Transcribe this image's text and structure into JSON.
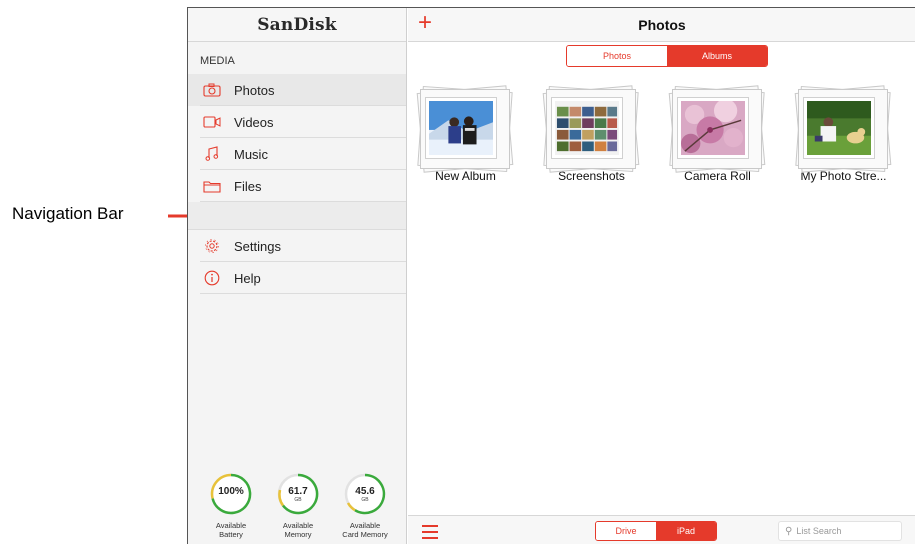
{
  "annotation": {
    "label": "Navigation Bar"
  },
  "sidebar": {
    "logo": "SanDisk",
    "section": "MEDIA",
    "media_items": [
      {
        "label": "Photos",
        "icon": "camera-icon",
        "active": true
      },
      {
        "label": "Videos",
        "icon": "video-icon"
      },
      {
        "label": "Music",
        "icon": "music-note-icon"
      },
      {
        "label": "Files",
        "icon": "folder-icon"
      }
    ],
    "other_items": [
      {
        "label": "Settings",
        "icon": "gear-icon"
      },
      {
        "label": "Help",
        "icon": "info-icon"
      }
    ],
    "gauges": [
      {
        "value": "100%",
        "unit": "",
        "label_line1": "Available",
        "label_line2": "Battery",
        "fraction": 1.0
      },
      {
        "value": "61.7",
        "unit": "GB",
        "label_line1": "Available",
        "label_line2": "Memory",
        "fraction": 0.7
      },
      {
        "value": "45.6",
        "unit": "GB",
        "label_line1": "Available",
        "label_line2": "Card Memory",
        "fraction": 0.6
      }
    ]
  },
  "main": {
    "title": "Photos",
    "view_toggle": {
      "left": "Photos",
      "right": "Albums",
      "selected": "Albums"
    },
    "albums": [
      {
        "name": "New Album",
        "thumb": "snow-couple"
      },
      {
        "name": "Screenshots",
        "thumb": "photo-grid"
      },
      {
        "name": "Camera Roll",
        "thumb": "cherry-blossom"
      },
      {
        "name": "My Photo Stre...",
        "thumb": "dog-park"
      }
    ],
    "source_toggle": {
      "left": "Drive",
      "right": "iPad",
      "selected": "iPad"
    },
    "search": {
      "placeholder": "List Search"
    }
  },
  "colors": {
    "accent": "#e53a2b",
    "gauge_green": "#3aaa3c",
    "gauge_yellow": "#e8c23a"
  }
}
